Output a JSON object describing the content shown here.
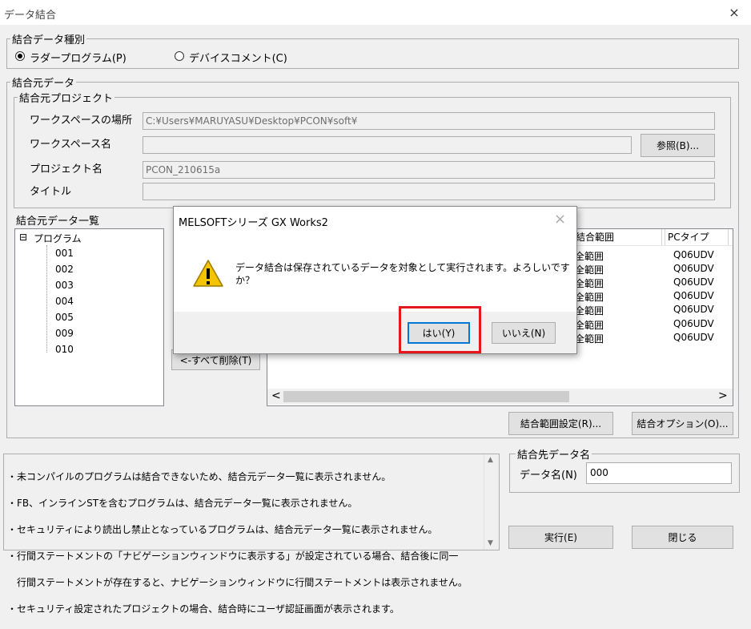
{
  "window": {
    "title": "データ結合",
    "close_icon": "×"
  },
  "merge_type": {
    "label": "結合データ種別",
    "options": [
      {
        "label": "ラダープログラム(P)",
        "selected": true
      },
      {
        "label": "デバイスコメント(C)",
        "selected": false
      }
    ]
  },
  "source_data": {
    "label": "結合元データ",
    "project_group": {
      "label": "結合元プロジェクト",
      "workspace_location_label": "ワークスペースの場所",
      "workspace_location_value": "C:¥Users¥MARUYASU¥Desktop¥PCON¥soft¥",
      "workspace_name_label": "ワークスペース名",
      "workspace_name_value": "",
      "browse_button": "参照(B)...",
      "project_name_label": "プロジェクト名",
      "project_name_value": "PCON_210615a",
      "title_label": "タイトル",
      "title_value": ""
    },
    "list_label": "結合元データ一覧",
    "tree": {
      "root": "プログラム",
      "root_toggle": "⊟",
      "children": [
        "001",
        "002",
        "003",
        "004",
        "005",
        "009",
        "010"
      ]
    },
    "delete_all_button": "<-すべて削除(T)"
  },
  "target_table": {
    "columns": [
      "結合範囲",
      "PCタイプ"
    ],
    "rows": [
      [
        "全範囲",
        "Q06UDV"
      ],
      [
        "全範囲",
        "Q06UDV"
      ],
      [
        "全範囲",
        "Q06UDV"
      ],
      [
        "全範囲",
        "Q06UDV"
      ],
      [
        "全範囲",
        "Q06UDV"
      ],
      [
        "全範囲",
        "Q06UDV"
      ],
      [
        "全範囲",
        "Q06UDV"
      ]
    ],
    "scroll_left": "<",
    "scroll_right": ">"
  },
  "range_settings_button": "結合範囲設定(R)...",
  "merge_options_button": "結合オプション(O)...",
  "notes": [
    "・未コンパイルのプログラムは結合できないため、結合元データ一覧に表示されません。",
    "・FB、インラインSTを含むプログラムは、結合元データ一覧に表示されません。",
    "・セキュリティにより読出し禁止となっているプログラムは、結合元データ一覧に表示されません。",
    "・行間ステートメントの「ナビゲーションウィンドウに表示する」が設定されている場合、結合後に同一",
    "　行間ステートメントが存在すると、ナビゲーションウィンドウに行間ステートメントは表示されません。",
    "・セキュリティ設定されたプロジェクトの場合、結合時にユーザ認証画面が表示されます。"
  ],
  "dest": {
    "label": "結合先データ名",
    "name_label": "データ名(N)",
    "name_value": "000"
  },
  "execute_button": "実行(E)",
  "close_button": "閉じる",
  "dialog": {
    "title": "MELSOFTシリーズ GX Works2",
    "close_icon": "×",
    "icon": "warning-icon",
    "message_line1": "データ結合は保存されているデータを対象として実行されます。よろしいです",
    "message_line2": "か？",
    "yes_button": "はい(Y)",
    "no_button": "いいえ(N)"
  },
  "colors": {
    "highlight": "#e3171c",
    "focus": "#0078d7",
    "warning": "#f5c400"
  }
}
